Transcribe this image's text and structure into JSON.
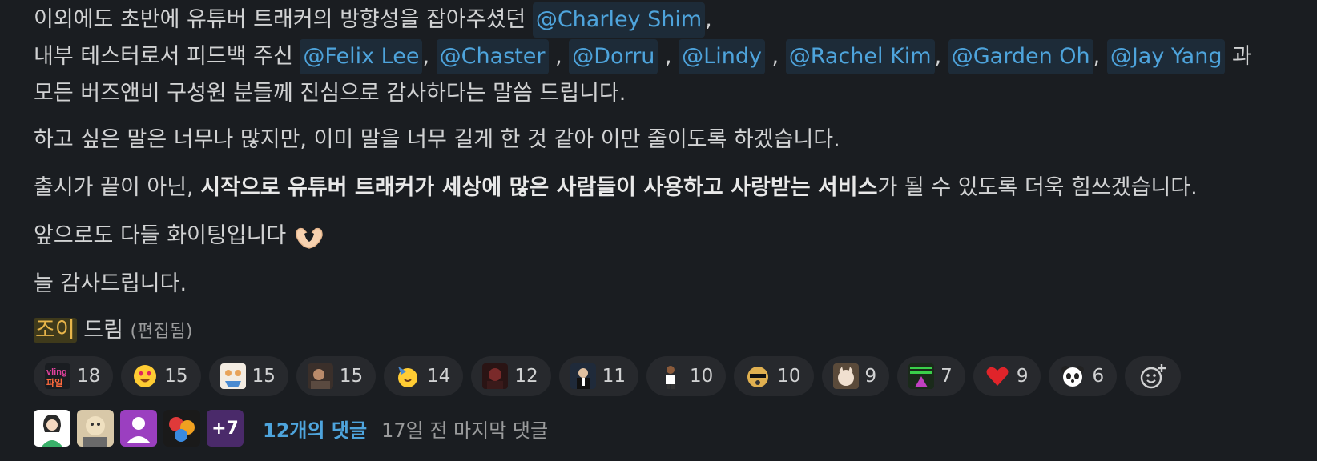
{
  "message": {
    "line1": {
      "text": "이외에도 초반에 유튜버 트래커의 방향성을 잡아주셨던 ",
      "mention": "@Charley Shim",
      "suffix": ","
    },
    "line2": {
      "prefix": "내부 테스터로서 피드백 주신 ",
      "mentions": [
        "@Felix Lee",
        "@Chaster",
        "@Dorru",
        "@Lindy",
        "@Rachel Kim",
        "@Garden Oh",
        "@Jay Yang"
      ],
      "suffix": " 과"
    },
    "line3": "모든 버즈앤비 구성원 분들께 진심으로 감사하다는 말씀 드립니다.",
    "line4": "하고 싶은 말은 너무나 많지만, 이미 말을 너무 길게 한 것 같아 이만 줄이도록 하겠습니다.",
    "line5": {
      "prefix": "출시가 끝이 아닌, ",
      "bold": "시작으로 유튜버 트래커가 세상에 많은 사람들이 사용하고 사랑받는 서비스",
      "suffix": "가 될 수 있도록 더욱 힘쓰겠습니다."
    },
    "line6": "앞으로도 다들 화이팅입니다",
    "line7": "늘 감사드립니다.",
    "signature": {
      "name": "조이",
      "suffix": " 드림",
      "edited": "(편집됨)"
    }
  },
  "reactions": [
    {
      "icon": "vling-logo-emoji",
      "count": "18"
    },
    {
      "icon": "heart-eyes-emoji",
      "count": "15"
    },
    {
      "icon": "celebrate-emoji",
      "count": "15"
    },
    {
      "icon": "custom-photo-emoji",
      "count": "15"
    },
    {
      "icon": "partying-face-emoji",
      "count": "14"
    },
    {
      "icon": "custom-photo-emoji",
      "count": "12"
    },
    {
      "icon": "gatsby-toast-emoji",
      "count": "11"
    },
    {
      "icon": "dancing-person-emoji",
      "count": "10"
    },
    {
      "icon": "doge-sunglasses-emoji",
      "count": "10"
    },
    {
      "icon": "cat-emoji",
      "count": "9"
    },
    {
      "icon": "custom-dance-emoji",
      "count": "7"
    },
    {
      "icon": "red-heart-emoji",
      "count": "9"
    },
    {
      "icon": "panda-emoji",
      "count": "6"
    }
  ],
  "thread": {
    "more_count": "+7",
    "replies": "12개의 댓글",
    "last_reply": "17일 전 마지막 댓글"
  },
  "colors": {
    "background": "#1a1d21",
    "mention": "#4ea4dc",
    "link": "#4ea4dc"
  }
}
